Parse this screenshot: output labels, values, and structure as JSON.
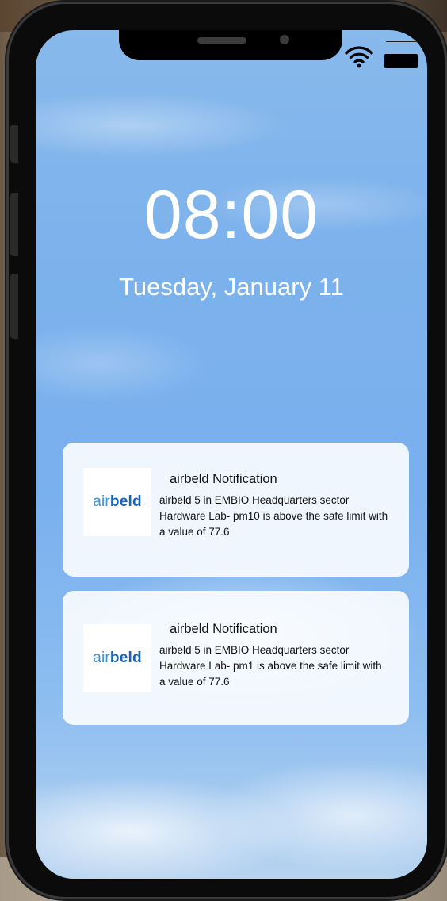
{
  "lockscreen": {
    "time": "08:00",
    "date": "Tuesday, January 11"
  },
  "status_bar": {
    "icons": [
      "wifi-icon",
      "battery-icon"
    ]
  },
  "notifications": [
    {
      "app_logo": {
        "part1": "air",
        "part2": "beld"
      },
      "title": "airbeld Notification",
      "body": "airbeld 5 in EMBIO Headquarters sector Hardware Lab- pm10 is above the safe limit with a value of 77.6"
    },
    {
      "app_logo": {
        "part1": "air",
        "part2": "beld"
      },
      "title": "airbeld Notification",
      "body": "airbeld 5 in EMBIO Headquarters sector Hardware Lab- pm1 is above the safe limit with a value of 77.6"
    }
  ],
  "colors": {
    "logo_air": "#3a93d6",
    "logo_beld": "#1a63b0",
    "sky": "#7db2ec"
  }
}
